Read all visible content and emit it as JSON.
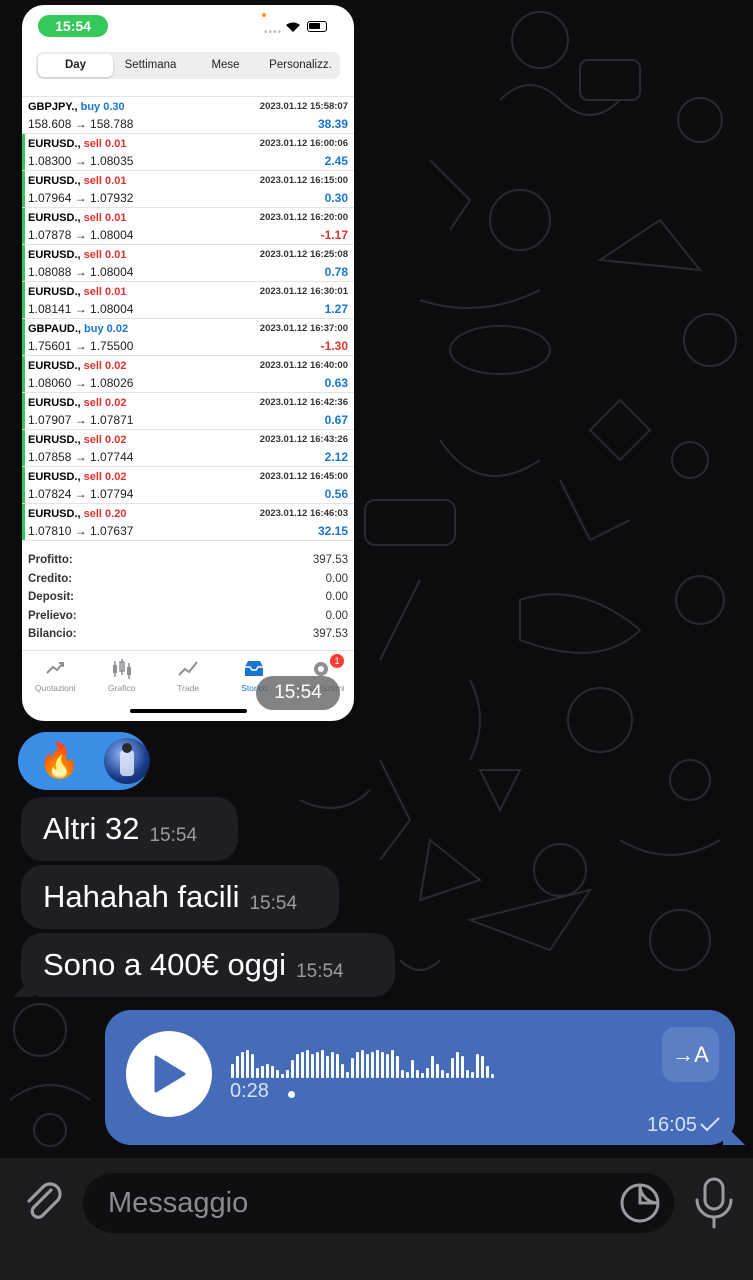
{
  "photo": {
    "status_time": "15:54",
    "segments": [
      "Day",
      "Settimana",
      "Mese",
      "Personalizz."
    ],
    "active_segment": 0,
    "trades": [
      {
        "symbol": "GBPJPY.,",
        "side": "buy",
        "lot": "0.30",
        "prices": "158.608 → 158.788",
        "datetime": "2023.01.12 15:58:07",
        "profit": "38.39",
        "positive": true
      },
      {
        "symbol": "EURUSD.,",
        "side": "sell",
        "lot": "0.01",
        "prices": "1.08300 → 1.08035",
        "datetime": "2023.01.12 16:00:06",
        "profit": "2.45",
        "positive": true
      },
      {
        "symbol": "EURUSD.,",
        "side": "sell",
        "lot": "0.01",
        "prices": "1.07964 → 1.07932",
        "datetime": "2023.01.12 16:15:00",
        "profit": "0.30",
        "positive": true
      },
      {
        "symbol": "EURUSD.,",
        "side": "sell",
        "lot": "0.01",
        "prices": "1.07878 → 1.08004",
        "datetime": "2023.01.12 16:20:00",
        "profit": "-1.17",
        "positive": false
      },
      {
        "symbol": "EURUSD.,",
        "side": "sell",
        "lot": "0.01",
        "prices": "1.08088 → 1.08004",
        "datetime": "2023.01.12 16:25:08",
        "profit": "0.78",
        "positive": true
      },
      {
        "symbol": "EURUSD.,",
        "side": "sell",
        "lot": "0.01",
        "prices": "1.08141 → 1.08004",
        "datetime": "2023.01.12 16:30:01",
        "profit": "1.27",
        "positive": true
      },
      {
        "symbol": "GBPAUD.,",
        "side": "buy",
        "lot": "0.02",
        "prices": "1.75601 → 1.75500",
        "datetime": "2023.01.12 16:37:00",
        "profit": "-1.30",
        "positive": false
      },
      {
        "symbol": "EURUSD.,",
        "side": "sell",
        "lot": "0.02",
        "prices": "1.08060 → 1.08026",
        "datetime": "2023.01.12 16:40:00",
        "profit": "0.63",
        "positive": true
      },
      {
        "symbol": "EURUSD.,",
        "side": "sell",
        "lot": "0.02",
        "prices": "1.07907 → 1.07871",
        "datetime": "2023.01.12 16:42:36",
        "profit": "0.67",
        "positive": true
      },
      {
        "symbol": "EURUSD.,",
        "side": "sell",
        "lot": "0.02",
        "prices": "1.07858 → 1.07744",
        "datetime": "2023.01.12 16:43:26",
        "profit": "2.12",
        "positive": true
      },
      {
        "symbol": "EURUSD.,",
        "side": "sell",
        "lot": "0.02",
        "prices": "1.07824 → 1.07794",
        "datetime": "2023.01.12 16:45:00",
        "profit": "0.56",
        "positive": true
      },
      {
        "symbol": "EURUSD.,",
        "side": "sell",
        "lot": "0.20",
        "prices": "1.07810 → 1.07637",
        "datetime": "2023.01.12 16:46:03",
        "profit": "32.15",
        "positive": true
      }
    ],
    "summary": [
      {
        "label": "Profitto:",
        "value": "397.53"
      },
      {
        "label": "Credito:",
        "value": "0.00"
      },
      {
        "label": "Deposit:",
        "value": "0.00"
      },
      {
        "label": "Prelievo:",
        "value": "0.00"
      },
      {
        "label": "Bilancio:",
        "value": "397.53"
      }
    ],
    "tabs": [
      {
        "label": "Quotazioni",
        "icon": "quotes-icon"
      },
      {
        "label": "Grafico",
        "icon": "chart-candles-icon"
      },
      {
        "label": "Trade",
        "icon": "trade-icon"
      },
      {
        "label": "Storico",
        "icon": "history-inbox-icon",
        "active": true
      },
      {
        "label": "Impostazioni",
        "icon": "settings-gear-icon",
        "badge": "1"
      }
    ],
    "photo_time": "15:54"
  },
  "reactions": {
    "emoji": "🔥"
  },
  "messages": [
    {
      "text": "Altri 32",
      "time": "15:54"
    },
    {
      "text": "Hahahah facili",
      "time": "15:54"
    },
    {
      "text": "Sono a 400€ oggi",
      "time": "15:54"
    }
  ],
  "voice": {
    "duration": "0:28",
    "time": "16:05",
    "transcribe_label": "→A",
    "bars": [
      14,
      22,
      26,
      28,
      24,
      10,
      12,
      14,
      12,
      8,
      4,
      8,
      18,
      24,
      26,
      28,
      24,
      26,
      28,
      22,
      26,
      24,
      14,
      6,
      20,
      26,
      28,
      24,
      26,
      28,
      26,
      24,
      28,
      22,
      8,
      6,
      18,
      8,
      5,
      10,
      22,
      14,
      8,
      5,
      20,
      26,
      22,
      8,
      6,
      24,
      22,
      12,
      4
    ]
  },
  "input": {
    "placeholder": "Messaggio"
  },
  "colors": {
    "outgoing_bubble": "#456cb8",
    "incoming_bubble": "#1f1f23",
    "reaction_bg": "#3a8ee6"
  }
}
